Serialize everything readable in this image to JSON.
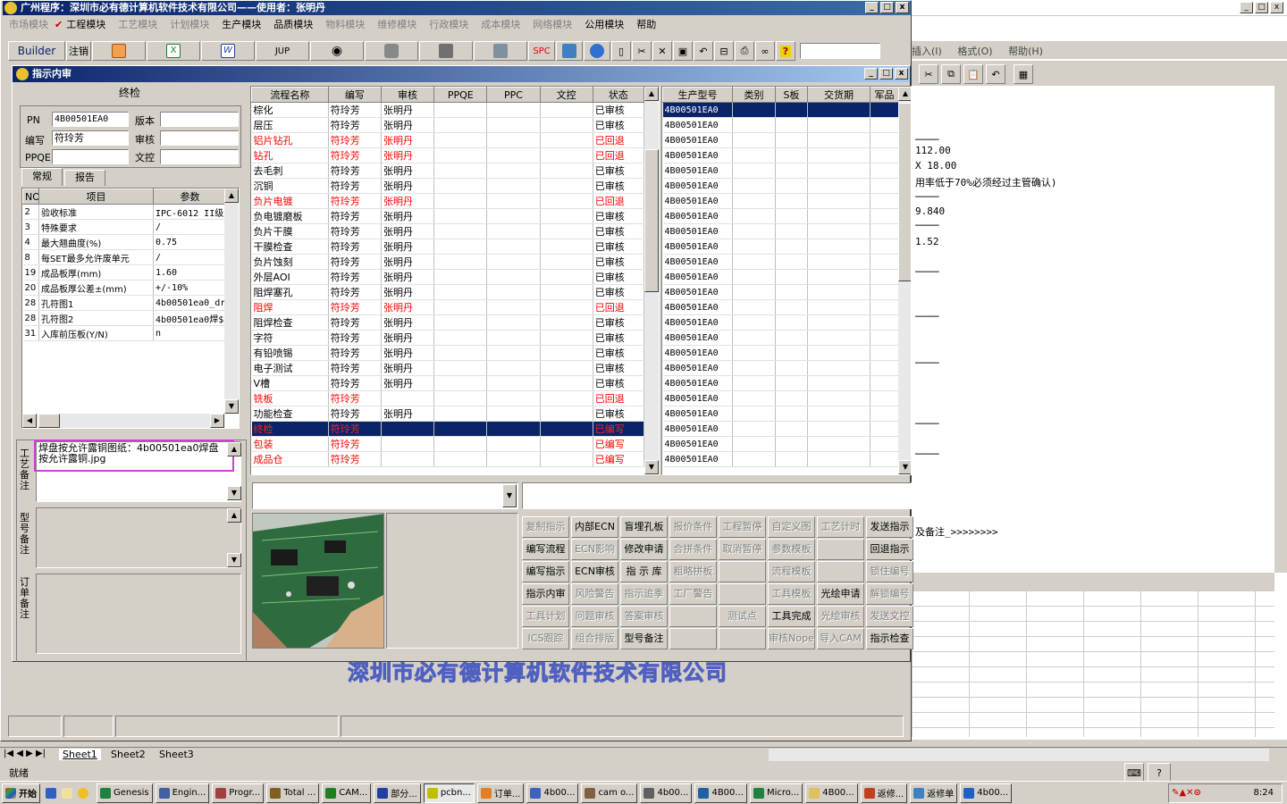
{
  "app": {
    "title": "广州程序：深圳市必有德计算机软件技术有限公司——使用者：张明丹",
    "menu": [
      "市场模块",
      "工程模块",
      "工艺模块",
      "计划模块",
      "生产模块",
      "品质模块",
      "物料模块",
      "维修模块",
      "行政模块",
      "成本模块",
      "网络模块",
      "公用模块",
      "帮助"
    ],
    "menu_disabled": [
      true,
      false,
      true,
      true,
      false,
      false,
      true,
      true,
      true,
      true,
      true,
      false,
      false
    ],
    "checked_menu": "工程模块"
  },
  "toolbar": {
    "builder": "Builder",
    "logout": "注销",
    "jup": "JUP",
    "spc": "SPC"
  },
  "inner": {
    "title": "指示内审"
  },
  "form": {
    "header": "终检",
    "pn_label": "PN",
    "pn": "4B00501EA0",
    "version_label": "版本",
    "version": "",
    "writer_label": "编写",
    "writer": "符玲芳",
    "reviewer_label": "审核",
    "reviewer": "",
    "ppqe_label": "PPQE",
    "ppqe": "",
    "wenkong_label": "文控",
    "wenkong": "",
    "tab_general": "常规",
    "tab_report": "报告"
  },
  "params": {
    "col_no": "NO",
    "col_item": "项目",
    "col_param": "参数",
    "rows": [
      [
        "2",
        "验收标准",
        "IPC-6012 II级"
      ],
      [
        "3",
        "特殊要求",
        "/"
      ],
      [
        "4",
        "最大翘曲度(%)",
        "0.75"
      ],
      [
        "8",
        "每SET最多允许废单元",
        "/"
      ],
      [
        "19",
        "成品板厚(mm)",
        "1.60"
      ],
      [
        "20",
        "成品板厚公差±(mm)",
        "+/-10%"
      ],
      [
        "28",
        "孔符图1",
        "4b00501ea0_dr"
      ],
      [
        "28",
        "孔符图2",
        "4b00501ea0焊$"
      ],
      [
        "31",
        "入库前压板(Y/N)",
        "n"
      ]
    ]
  },
  "notes": {
    "craft_label": "工艺备注",
    "craft_text": "焊盘按允许露铜图纸：4b00501ea0焊盘按允许露铜.jpg",
    "model_label": "型号备注",
    "order_label": "订单备注"
  },
  "flow": {
    "headers": [
      "流程名称",
      "编写",
      "审核",
      "PPQE",
      "PPC",
      "文控",
      "状态"
    ],
    "rows": [
      {
        "c": [
          "棕化",
          "符玲芳",
          "张明丹",
          "",
          "",
          "",
          "已审核"
        ],
        "s": ""
      },
      {
        "c": [
          "层压",
          "符玲芳",
          "张明丹",
          "",
          "",
          "",
          "已审核"
        ],
        "s": ""
      },
      {
        "c": [
          "铝片钻孔",
          "符玲芳",
          "张明丹",
          "",
          "",
          "",
          "已回退"
        ],
        "s": "red"
      },
      {
        "c": [
          "钻孔",
          "符玲芳",
          "张明丹",
          "",
          "",
          "",
          "已回退"
        ],
        "s": "red"
      },
      {
        "c": [
          "去毛刺",
          "符玲芳",
          "张明丹",
          "",
          "",
          "",
          "已审核"
        ],
        "s": ""
      },
      {
        "c": [
          "沉铜",
          "符玲芳",
          "张明丹",
          "",
          "",
          "",
          "已审核"
        ],
        "s": ""
      },
      {
        "c": [
          "负片电镀",
          "符玲芳",
          "张明丹",
          "",
          "",
          "",
          "已回退"
        ],
        "s": "red"
      },
      {
        "c": [
          "负电镀磨板",
          "符玲芳",
          "张明丹",
          "",
          "",
          "",
          "已审核"
        ],
        "s": ""
      },
      {
        "c": [
          "负片干膜",
          "符玲芳",
          "张明丹",
          "",
          "",
          "",
          "已审核"
        ],
        "s": ""
      },
      {
        "c": [
          "干膜检查",
          "符玲芳",
          "张明丹",
          "",
          "",
          "",
          "已审核"
        ],
        "s": ""
      },
      {
        "c": [
          "负片蚀刻",
          "符玲芳",
          "张明丹",
          "",
          "",
          "",
          "已审核"
        ],
        "s": ""
      },
      {
        "c": [
          "外层AOI",
          "符玲芳",
          "张明丹",
          "",
          "",
          "",
          "已审核"
        ],
        "s": ""
      },
      {
        "c": [
          "阻焊塞孔",
          "符玲芳",
          "张明丹",
          "",
          "",
          "",
          "已审核"
        ],
        "s": ""
      },
      {
        "c": [
          "阻焊",
          "符玲芳",
          "张明丹",
          "",
          "",
          "",
          "已回退"
        ],
        "s": "red"
      },
      {
        "c": [
          "阻焊检查",
          "符玲芳",
          "张明丹",
          "",
          "",
          "",
          "已审核"
        ],
        "s": ""
      },
      {
        "c": [
          "字符",
          "符玲芳",
          "张明丹",
          "",
          "",
          "",
          "已审核"
        ],
        "s": ""
      },
      {
        "c": [
          "有铅喷锡",
          "符玲芳",
          "张明丹",
          "",
          "",
          "",
          "已审核"
        ],
        "s": ""
      },
      {
        "c": [
          "电子测试",
          "符玲芳",
          "张明丹",
          "",
          "",
          "",
          "已审核"
        ],
        "s": ""
      },
      {
        "c": [
          "V槽",
          "符玲芳",
          "张明丹",
          "",
          "",
          "",
          "已审核"
        ],
        "s": ""
      },
      {
        "c": [
          "铣板",
          "符玲芳",
          "",
          "",
          "",
          "",
          "已回退"
        ],
        "s": "red"
      },
      {
        "c": [
          "功能检查",
          "符玲芳",
          "张明丹",
          "",
          "",
          "",
          "已审核"
        ],
        "s": ""
      },
      {
        "c": [
          "终检",
          "符玲芳",
          "",
          "",
          "",
          "",
          "已编写"
        ],
        "s": "sel"
      },
      {
        "c": [
          "包装",
          "符玲芳",
          "",
          "",
          "",
          "",
          "已编写"
        ],
        "s": "red"
      },
      {
        "c": [
          "成品仓",
          "符玲芳",
          "",
          "",
          "",
          "",
          "已编写"
        ],
        "s": "red"
      }
    ]
  },
  "models": {
    "headers": [
      "生产型号",
      "类别",
      "S板",
      "交货期",
      "军品"
    ],
    "value": "4B00501EA0",
    "count": 24
  },
  "actions": [
    [
      "复制指示",
      "内部ECN",
      "盲埋孔板",
      "报价条件",
      "工程暂停",
      "自定义图",
      "工艺计时",
      "发送指示"
    ],
    [
      "编写流程",
      "ECN影响",
      "修改申请",
      "合拼条件",
      "取消暂停",
      "参数模板",
      "",
      "回退指示"
    ],
    [
      "编写指示",
      "ECN审核",
      "指 示 库",
      "粗略拼板",
      "",
      "流程模板",
      "",
      "锁住编号"
    ],
    [
      "指示内审",
      "风险警告",
      "指示追季",
      "工厂警告",
      "",
      "工具模板",
      "光绘申请",
      "解锁编号"
    ],
    [
      "工具计划",
      "问题审核",
      "答案审核",
      "",
      "测试点",
      "工具完成",
      "光绘审核",
      "发送文控"
    ],
    [
      "ICS跟踪",
      "组合排版",
      "型号备注",
      "",
      "",
      "审核Nope",
      "导入CAM",
      "指示检查"
    ]
  ],
  "actions_enabled": [
    [
      false,
      true,
      true,
      false,
      false,
      false,
      false,
      true
    ],
    [
      true,
      false,
      true,
      false,
      false,
      false,
      false,
      true
    ],
    [
      true,
      true,
      true,
      false,
      false,
      false,
      false,
      false
    ],
    [
      true,
      false,
      false,
      false,
      false,
      false,
      true,
      false
    ],
    [
      false,
      false,
      false,
      false,
      false,
      true,
      false,
      false
    ],
    [
      false,
      false,
      true,
      false,
      false,
      false,
      false,
      true
    ]
  ],
  "company_watermark": "深圳市必有德计算机软件技术有限公司",
  "excel": {
    "menu": [
      "插入(I)",
      "格式(O)",
      "帮助(H)"
    ],
    "lines": [
      "112.00",
      "X 18.00",
      "用率低于70%必须经过主管确认)",
      "9.840",
      "1.52",
      "及备注_>>>>>>>>"
    ],
    "sheets": [
      "Sheet1",
      "Sheet2",
      "Sheet3"
    ],
    "status": "就绪"
  },
  "taskbar": {
    "start": "开始",
    "tasks": [
      "Genesis",
      "Engin...",
      "Progr...",
      "Total ...",
      "CAM...",
      "部分...",
      "pcbn...",
      "订单...",
      "4b00...",
      "cam o...",
      "4b00...",
      "4B00...",
      "Micro...",
      "4B00...",
      "返修...",
      "返修单",
      "4b00..."
    ],
    "clock": "8:24"
  }
}
